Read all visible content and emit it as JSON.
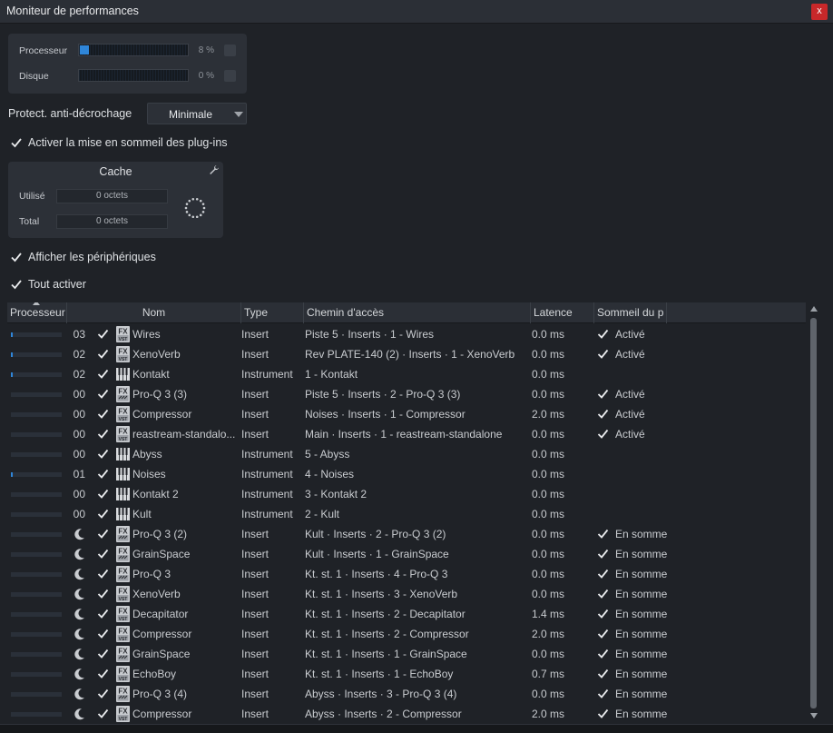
{
  "window": {
    "title": "Moniteur de performances",
    "close_label": "x"
  },
  "meters": {
    "processeur": {
      "label": "Processeur",
      "value_text": "8 %",
      "fraction": 0.08
    },
    "disque": {
      "label": "Disque",
      "value_text": "0 %",
      "fraction": 0.0
    }
  },
  "protection": {
    "label": "Protect. anti-décrochage",
    "selected": "Minimale"
  },
  "options": {
    "sleep_plugins": "Activer la mise en sommeil des plug-ins",
    "show_devices": "Afficher les périphériques",
    "enable_all": "Tout activer"
  },
  "cache": {
    "title": "Cache",
    "used_label": "Utilisé",
    "used_value": "0 octets",
    "total_label": "Total",
    "total_value": "0 octets"
  },
  "table": {
    "headers": [
      "Processeur",
      "Nom",
      "Type",
      "Chemin d'accès",
      "Latence",
      "Sommeil du p"
    ],
    "rows": [
      {
        "cpu": 0.03,
        "num": "03",
        "sleeping": false,
        "checked": true,
        "icon": "fx-vst-icon",
        "name": "Wires",
        "type": "Insert",
        "path": "Piste 5 · Inserts · 1 - Wires",
        "latency": "0.0 ms",
        "sleep_checked": true,
        "sleep": "Activé"
      },
      {
        "cpu": 0.02,
        "num": "02",
        "sleeping": false,
        "checked": true,
        "icon": "fx-vst-icon",
        "name": "XenoVerb",
        "type": "Insert",
        "path": "Rev PLATE-140 (2) · Inserts · 1 - XenoVerb",
        "latency": "0.0 ms",
        "sleep_checked": true,
        "sleep": "Activé"
      },
      {
        "cpu": 0.02,
        "num": "02",
        "sleeping": false,
        "checked": true,
        "icon": "instrument-icon",
        "name": "Kontakt",
        "type": "Instrument",
        "path": "1 - Kontakt",
        "latency": "0.0 ms",
        "sleep_checked": false,
        "sleep": ""
      },
      {
        "cpu": 0,
        "num": "00",
        "sleeping": false,
        "checked": true,
        "icon": "fx-vst3-icon",
        "name": "Pro-Q 3 (3)",
        "type": "Insert",
        "path": "Piste 5 · Inserts · 2 - Pro-Q 3 (3)",
        "latency": "0.0 ms",
        "sleep_checked": true,
        "sleep": "Activé"
      },
      {
        "cpu": 0,
        "num": "00",
        "sleeping": false,
        "checked": true,
        "icon": "fx-vst-icon",
        "name": "Compressor",
        "type": "Insert",
        "path": "Noises · Inserts · 1 - Compressor",
        "latency": "2.0 ms",
        "sleep_checked": true,
        "sleep": "Activé"
      },
      {
        "cpu": 0,
        "num": "00",
        "sleeping": false,
        "checked": true,
        "icon": "fx-vst-icon",
        "name": "reastream-standalo...",
        "type": "Insert",
        "path": "Main · Inserts · 1 - reastream-standalone",
        "latency": "0.0 ms",
        "sleep_checked": true,
        "sleep": "Activé"
      },
      {
        "cpu": 0,
        "num": "00",
        "sleeping": false,
        "checked": true,
        "icon": "instrument-icon",
        "name": "Abyss",
        "type": "Instrument",
        "path": "5 - Abyss",
        "latency": "0.0 ms",
        "sleep_checked": false,
        "sleep": ""
      },
      {
        "cpu": 0.01,
        "num": "01",
        "sleeping": false,
        "checked": true,
        "icon": "instrument-icon",
        "name": "Noises",
        "type": "Instrument",
        "path": "4 - Noises",
        "latency": "0.0 ms",
        "sleep_checked": false,
        "sleep": ""
      },
      {
        "cpu": 0,
        "num": "00",
        "sleeping": false,
        "checked": true,
        "icon": "instrument-icon",
        "name": "Kontakt 2",
        "type": "Instrument",
        "path": "3 - Kontakt 2",
        "latency": "0.0 ms",
        "sleep_checked": false,
        "sleep": ""
      },
      {
        "cpu": 0,
        "num": "00",
        "sleeping": false,
        "checked": true,
        "icon": "instrument-icon",
        "name": "Kult",
        "type": "Instrument",
        "path": "2 - Kult",
        "latency": "0.0 ms",
        "sleep_checked": false,
        "sleep": ""
      },
      {
        "cpu": 0,
        "num": "",
        "sleeping": true,
        "checked": true,
        "icon": "fx-vst3-icon",
        "name": "Pro-Q 3 (2)",
        "type": "Insert",
        "path": "Kult · Inserts · 2 - Pro-Q 3 (2)",
        "latency": "0.0 ms",
        "sleep_checked": true,
        "sleep": "En somme"
      },
      {
        "cpu": 0,
        "num": "",
        "sleeping": true,
        "checked": true,
        "icon": "fx-vst3-icon",
        "name": "GrainSpace",
        "type": "Insert",
        "path": "Kult · Inserts · 1 - GrainSpace",
        "latency": "0.0 ms",
        "sleep_checked": true,
        "sleep": "En somme"
      },
      {
        "cpu": 0,
        "num": "",
        "sleeping": true,
        "checked": true,
        "icon": "fx-vst3-icon",
        "name": "Pro-Q 3",
        "type": "Insert",
        "path": "Kt. st. 1 · Inserts · 4 - Pro-Q 3",
        "latency": "0.0 ms",
        "sleep_checked": true,
        "sleep": "En somme"
      },
      {
        "cpu": 0,
        "num": "",
        "sleeping": true,
        "checked": true,
        "icon": "fx-vst-icon",
        "name": "XenoVerb",
        "type": "Insert",
        "path": "Kt. st. 1 · Inserts · 3 - XenoVerb",
        "latency": "0.0 ms",
        "sleep_checked": true,
        "sleep": "En somme"
      },
      {
        "cpu": 0,
        "num": "",
        "sleeping": true,
        "checked": true,
        "icon": "fx-vst-icon",
        "name": "Decapitator",
        "type": "Insert",
        "path": "Kt. st. 1 · Inserts · 2 - Decapitator",
        "latency": "1.4 ms",
        "sleep_checked": true,
        "sleep": "En somme"
      },
      {
        "cpu": 0,
        "num": "",
        "sleeping": true,
        "checked": true,
        "icon": "fx-vst-icon",
        "name": "Compressor",
        "type": "Insert",
        "path": "Kt. st. 1 · Inserts · 2 - Compressor",
        "latency": "2.0 ms",
        "sleep_checked": true,
        "sleep": "En somme"
      },
      {
        "cpu": 0,
        "num": "",
        "sleeping": true,
        "checked": true,
        "icon": "fx-vst3-icon",
        "name": "GrainSpace",
        "type": "Insert",
        "path": "Kt. st. 1 · Inserts · 1 - GrainSpace",
        "latency": "0.0 ms",
        "sleep_checked": true,
        "sleep": "En somme"
      },
      {
        "cpu": 0,
        "num": "",
        "sleeping": true,
        "checked": true,
        "icon": "fx-vst-icon",
        "name": "EchoBoy",
        "type": "Insert",
        "path": "Kt. st. 1 · Inserts · 1 - EchoBoy",
        "latency": "0.7 ms",
        "sleep_checked": true,
        "sleep": "En somme"
      },
      {
        "cpu": 0,
        "num": "",
        "sleeping": true,
        "checked": true,
        "icon": "fx-vst3-icon",
        "name": "Pro-Q 3 (4)",
        "type": "Insert",
        "path": "Abyss · Inserts · 3 - Pro-Q 3 (4)",
        "latency": "0.0 ms",
        "sleep_checked": true,
        "sleep": "En somme"
      },
      {
        "cpu": 0,
        "num": "",
        "sleeping": true,
        "checked": true,
        "icon": "fx-vst-icon",
        "name": "Compressor",
        "type": "Insert",
        "path": "Abyss · Inserts · 2 - Compressor",
        "latency": "2.0 ms",
        "sleep_checked": true,
        "sleep": "En somme"
      }
    ]
  },
  "colors": {
    "accent": "#2f86d9",
    "background": "#1f2227",
    "panel": "#2c3037",
    "close": "#c8282a"
  }
}
